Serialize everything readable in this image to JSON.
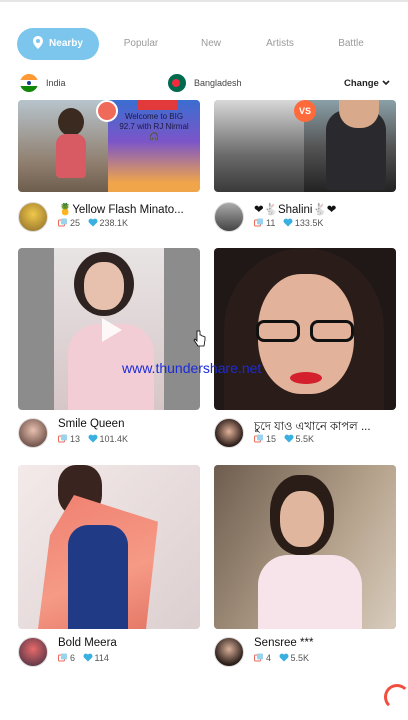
{
  "tabs": [
    {
      "label": "Nearby",
      "active": true
    },
    {
      "label": "Popular",
      "active": false
    },
    {
      "label": "New",
      "active": false
    },
    {
      "label": "Artists",
      "active": false
    },
    {
      "label": "Battle",
      "active": false
    }
  ],
  "location": {
    "current": "India",
    "other": "Bangladesh",
    "change_label": "Change"
  },
  "cards": [
    {
      "name": "🍍Yellow Flash Minato...",
      "broadcasts": "25",
      "likes": "238.1K",
      "overlay_text": "Welcome to BIG 92.7 with RJ Nirmal 🎧"
    },
    {
      "name": "❤🐇Shalini🐇❤",
      "broadcasts": "11",
      "likes": "133.5K",
      "overlay_badge": "VS"
    },
    {
      "name": "Smile Queen",
      "broadcasts": "13",
      "likes": "101.4K"
    },
    {
      "name": "চুদে যাও এখানে কাপল ...",
      "broadcasts": "15",
      "likes": "5.5K"
    },
    {
      "name": "Bold Meera",
      "broadcasts": "6",
      "likes": "114"
    },
    {
      "name": "Sensree ***",
      "broadcasts": "4",
      "likes": "5.5K"
    }
  ],
  "watermark": "www.thundershare.net",
  "colors": {
    "active_tab": "#7cc6ee",
    "like_icon": "#39b0e0",
    "broadcast_icon": "#e86a5a",
    "spinner": "#f04e3e",
    "watermark": "#1b2bd8"
  },
  "icons": [
    "location-pin-icon",
    "chevron-down-icon",
    "broadcast-icon",
    "heart-icon",
    "play-icon",
    "loading-spinner-icon"
  ]
}
